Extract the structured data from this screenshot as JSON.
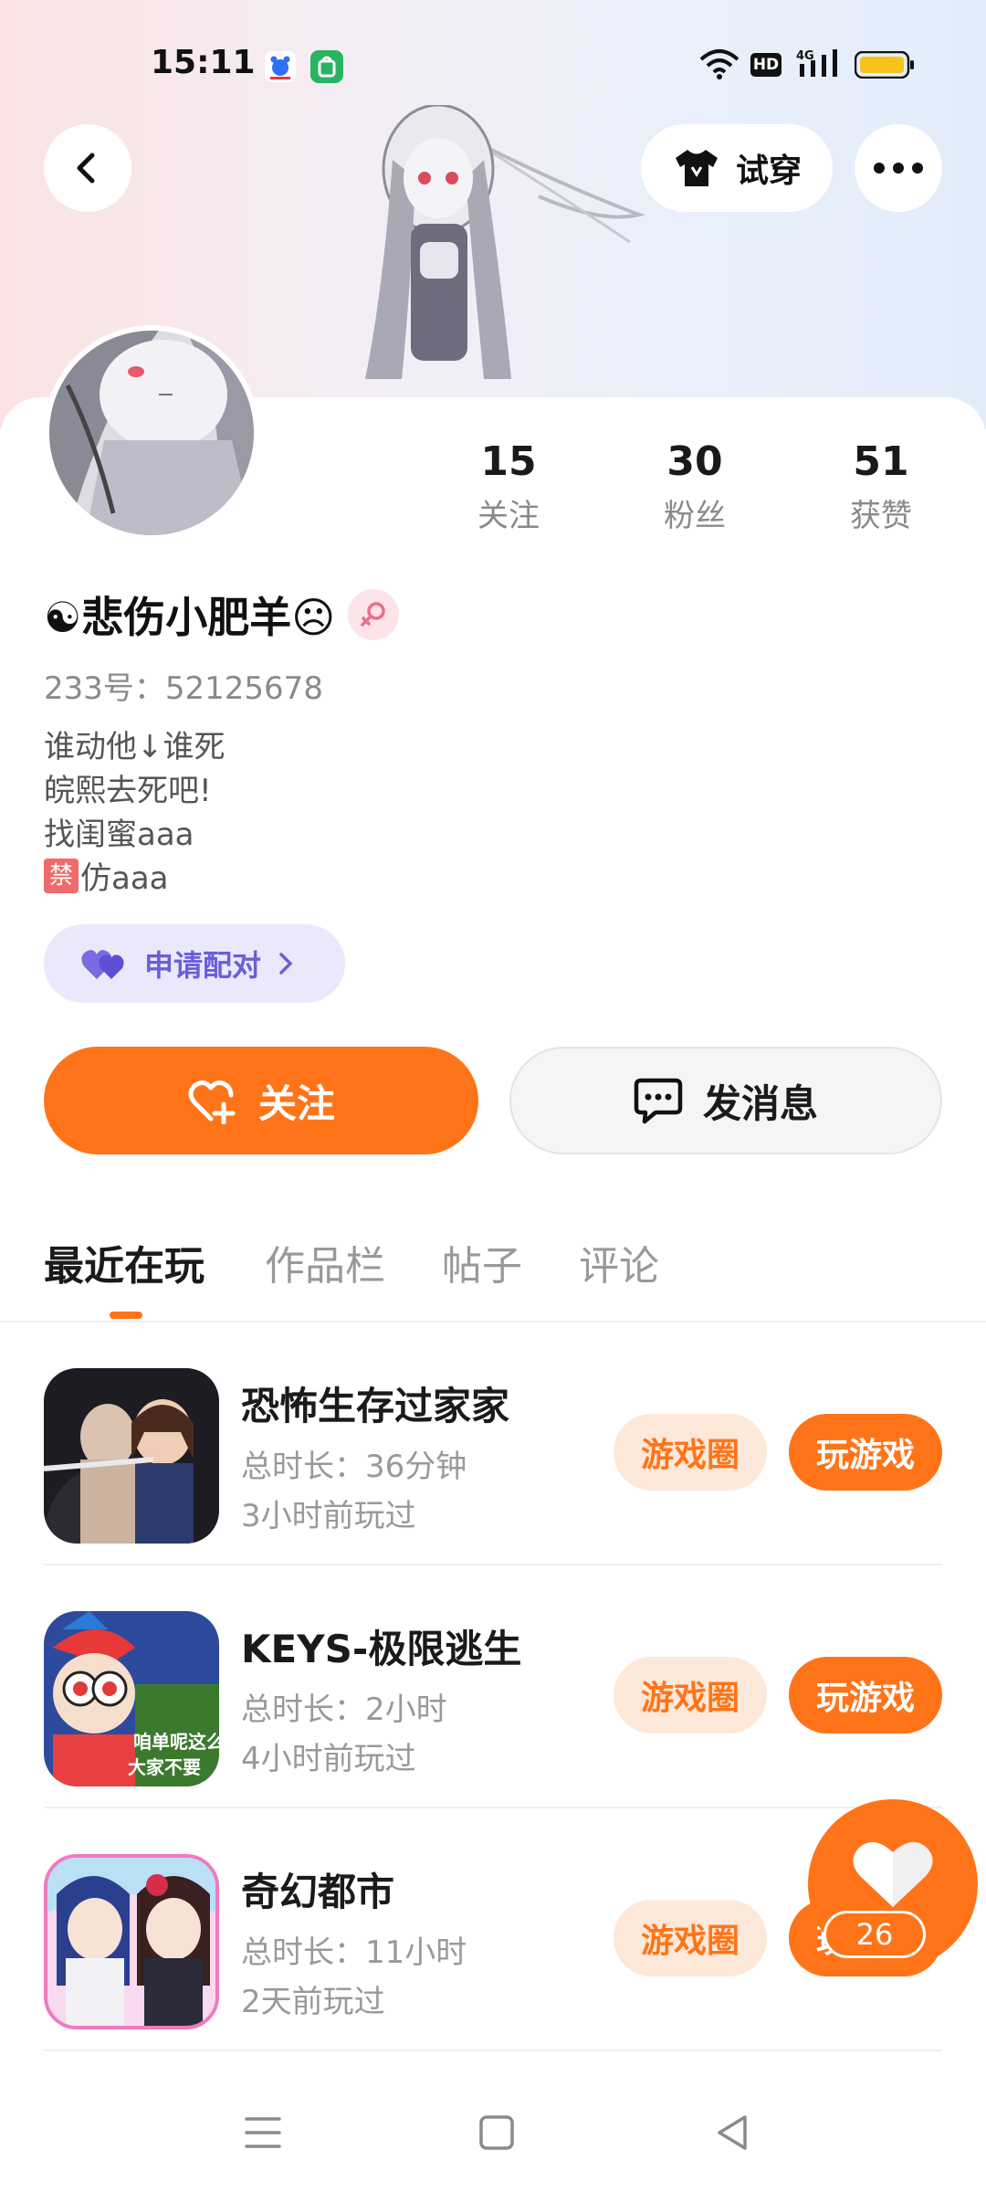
{
  "status_bar": {
    "time": "15:11",
    "network": "4G",
    "hd": "HD"
  },
  "header": {
    "try_on_label": "试穿"
  },
  "profile": {
    "name": "☯悲伤小肥羊☹",
    "gender": "female",
    "id_text": "233号：52125678",
    "bio": [
      "谁动他↓谁死",
      "皖熙去死吧!",
      "找闺蜜aaa",
      "仿aaa"
    ],
    "bio_badge": "禁",
    "stats": [
      {
        "value": "15",
        "label": "关注"
      },
      {
        "value": "30",
        "label": "粉丝"
      },
      {
        "value": "51",
        "label": "获赞"
      }
    ],
    "match_label": "申请配对"
  },
  "actions": {
    "follow": "关注",
    "message": "发消息"
  },
  "tabs": [
    "最近在玩",
    "作品栏",
    "帖子",
    "评论"
  ],
  "games": [
    {
      "title": "恐怖生存过家家",
      "duration": "总时长：36分钟",
      "last": "3小时前玩过",
      "circle": "游戏圈",
      "play": "玩游戏"
    },
    {
      "title": "KEYS-极限逃生",
      "duration": "总时长：2小时",
      "last": "4小时前玩过",
      "circle": "游戏圈",
      "play": "玩游戏",
      "icon_caption_1": "咱单呢这么",
      "icon_caption_2": "大家不要"
    },
    {
      "title": "奇幻都市",
      "duration": "总时长：11小时",
      "last": "2天前玩过",
      "circle": "游戏圈",
      "play": "玩游戏"
    }
  ],
  "fab": {
    "count": "26"
  },
  "colors": {
    "accent": "#ff7418",
    "match": "#6a5fd6"
  }
}
